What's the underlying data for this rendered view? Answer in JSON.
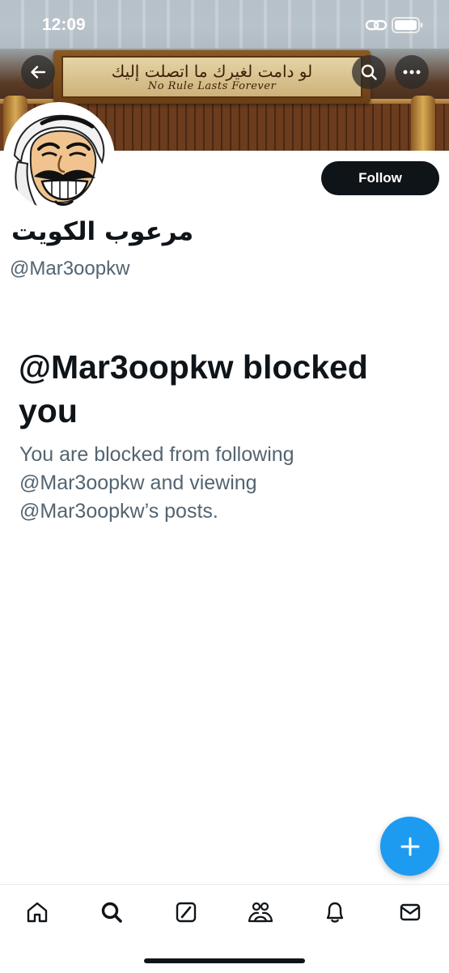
{
  "status_bar": {
    "time": "12:09"
  },
  "banner": {
    "plaque_arabic": "لو دامت لغيرك ما اتصلت إليك",
    "plaque_english": "No Rule Lasts Forever"
  },
  "profile": {
    "display_name": "مرعوب الكويت",
    "handle": "@Mar3oopkw",
    "follow_label": "Follow"
  },
  "blocked": {
    "title": "@Mar3oopkw blocked you",
    "description": "You are blocked from following @Mar3oopkw and viewing @Mar3oopkw’s posts."
  },
  "icons": {
    "back": "arrow-left-icon",
    "search": "search-icon",
    "more": "more-horizontal-icon",
    "fab": "plus-icon",
    "nav": [
      "home-icon",
      "search-icon",
      "grok-icon",
      "communities-icon",
      "notifications-icon",
      "messages-icon"
    ]
  },
  "colors": {
    "accent": "#1d9bf0",
    "text_primary": "#0f1419",
    "text_secondary": "#536471",
    "follow_bg": "#0f1419"
  }
}
